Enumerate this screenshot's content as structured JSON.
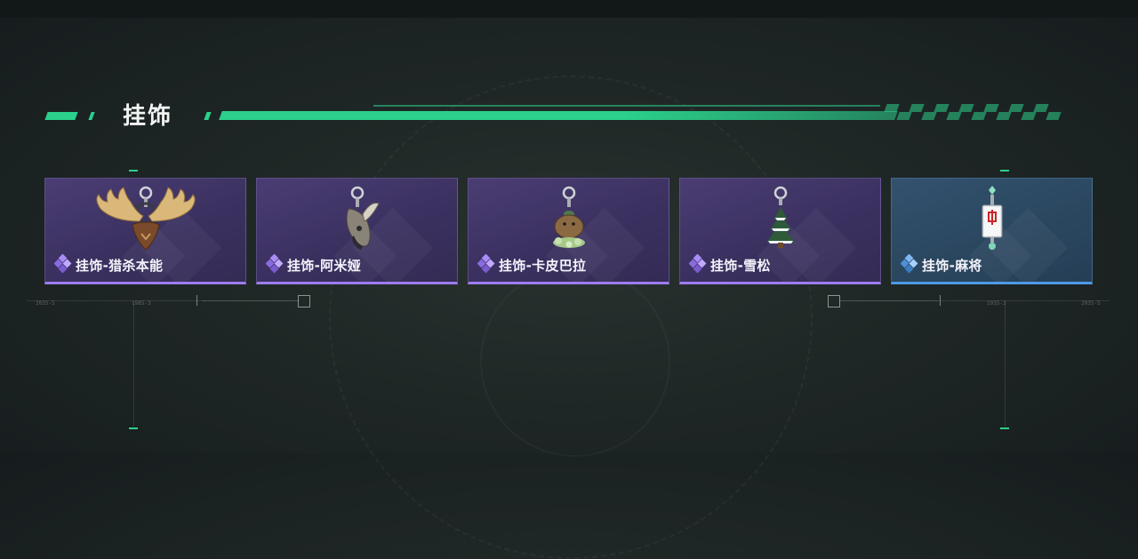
{
  "section": {
    "title": "挂饰",
    "accent": "#2bd08c"
  },
  "items": [
    {
      "label": "挂饰-猎杀本能",
      "icon": "moose-antler-charm-icon",
      "rarity": "purple"
    },
    {
      "label": "挂饰-阿米娅",
      "icon": "rabbit-plush-charm-icon",
      "rarity": "purple"
    },
    {
      "label": "挂饰-卡皮巴拉",
      "icon": "capybara-charm-icon",
      "rarity": "purple"
    },
    {
      "label": "挂饰-雪松",
      "icon": "snowy-pine-charm-icon",
      "rarity": "purple"
    },
    {
      "label": "挂饰-麻将",
      "icon": "mahjong-tile-charm-icon",
      "rarity": "blue"
    }
  ],
  "colors": {
    "purple_rarity": "#9d7cf0",
    "blue_rarity": "#4e9ae6"
  },
  "hud_labels": [
    "2035-5",
    "1985-3",
    "1935-3",
    "2035-5"
  ]
}
